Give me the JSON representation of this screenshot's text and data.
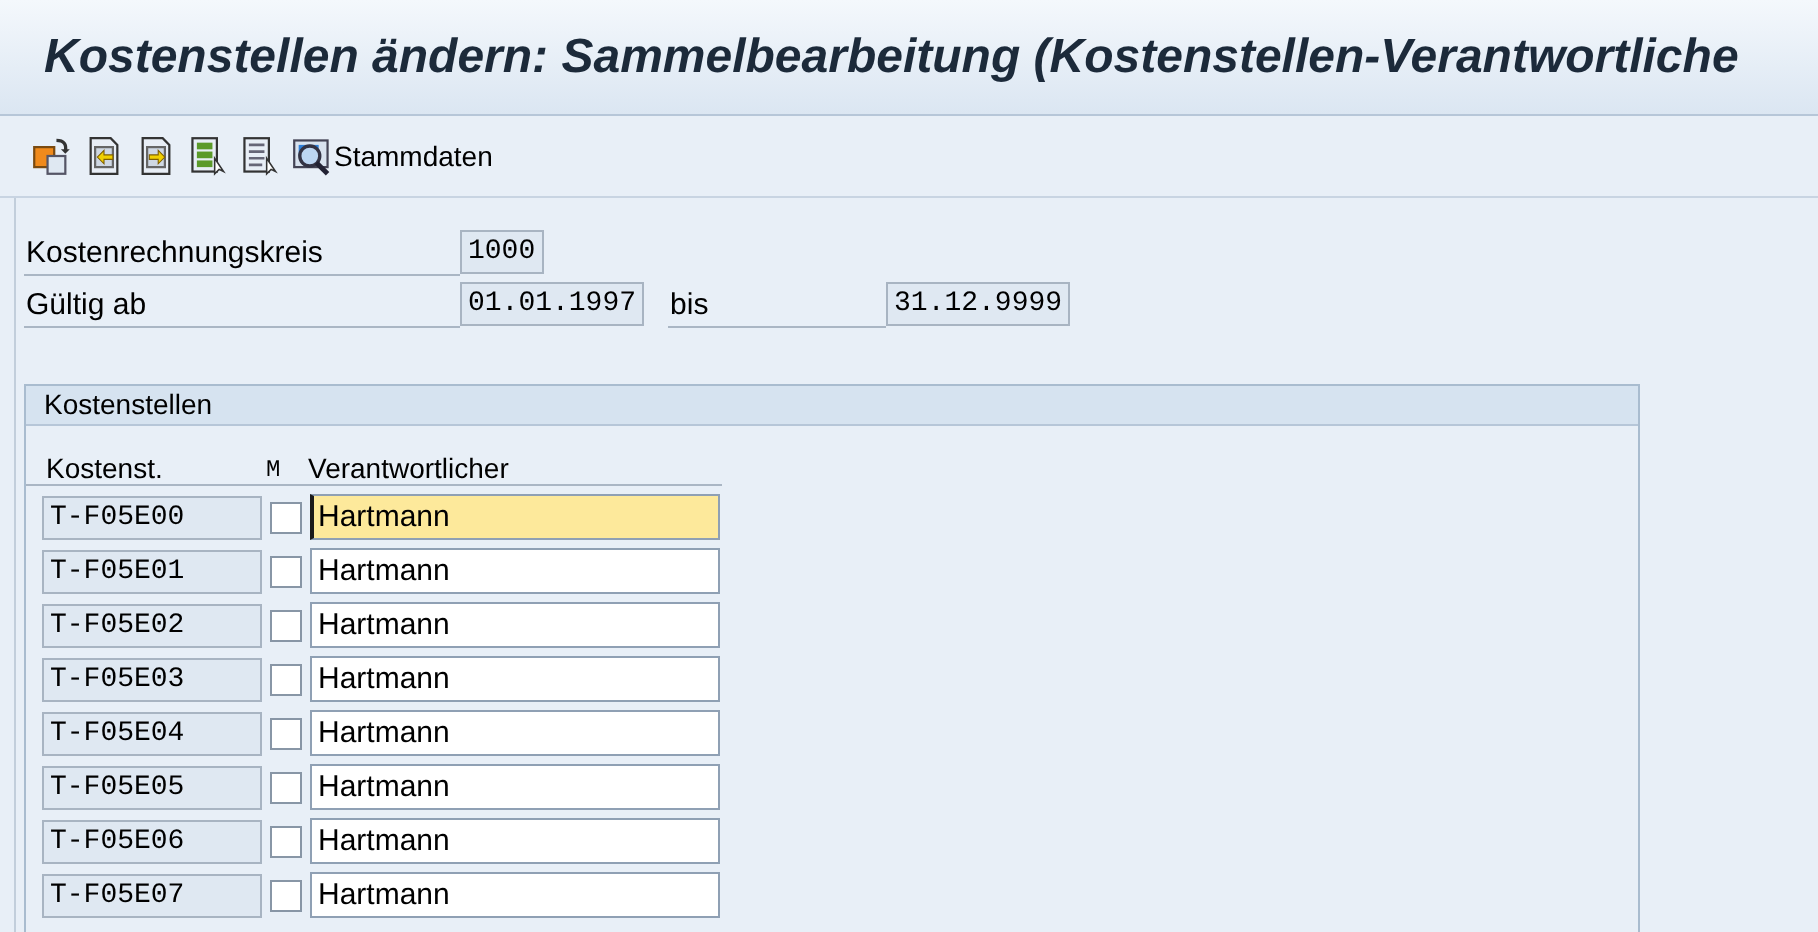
{
  "window": {
    "title": "Kostenstellen ändern: Sammelbearbeitung (Kostenstellen-Verantwortliche"
  },
  "toolbar": {
    "items": [
      {
        "kind": "icon"
      },
      {
        "kind": "icon"
      },
      {
        "kind": "icon"
      },
      {
        "kind": "icon"
      },
      {
        "kind": "icon"
      },
      {
        "kind": "text",
        "label": "Stammdaten"
      }
    ]
  },
  "header": {
    "controlling_area": {
      "label": "Kostenrechnungskreis",
      "value": "1000"
    },
    "valid_from": {
      "label": "Gültig ab",
      "value": "01.01.1997"
    },
    "valid_to": {
      "label": "bis",
      "value": "31.12.9999"
    }
  },
  "group": {
    "title": "Kostenstellen",
    "columns": [
      "Kostenst.",
      "M",
      "Verantwortlicher"
    ],
    "rows": [
      {
        "cost_center": "T-F05E00",
        "checked": false,
        "responsible": "Hartmann",
        "focused": true
      },
      {
        "cost_center": "T-F05E01",
        "checked": false,
        "responsible": "Hartmann",
        "focused": false
      },
      {
        "cost_center": "T-F05E02",
        "checked": false,
        "responsible": "Hartmann",
        "focused": false
      },
      {
        "cost_center": "T-F05E03",
        "checked": false,
        "responsible": "Hartmann",
        "focused": false
      },
      {
        "cost_center": "T-F05E04",
        "checked": false,
        "responsible": "Hartmann",
        "focused": false
      },
      {
        "cost_center": "T-F05E05",
        "checked": false,
        "responsible": "Hartmann",
        "focused": false
      },
      {
        "cost_center": "T-F05E06",
        "checked": false,
        "responsible": "Hartmann",
        "focused": false
      },
      {
        "cost_center": "T-F05E07",
        "checked": false,
        "responsible": "Hartmann",
        "focused": false
      }
    ]
  }
}
